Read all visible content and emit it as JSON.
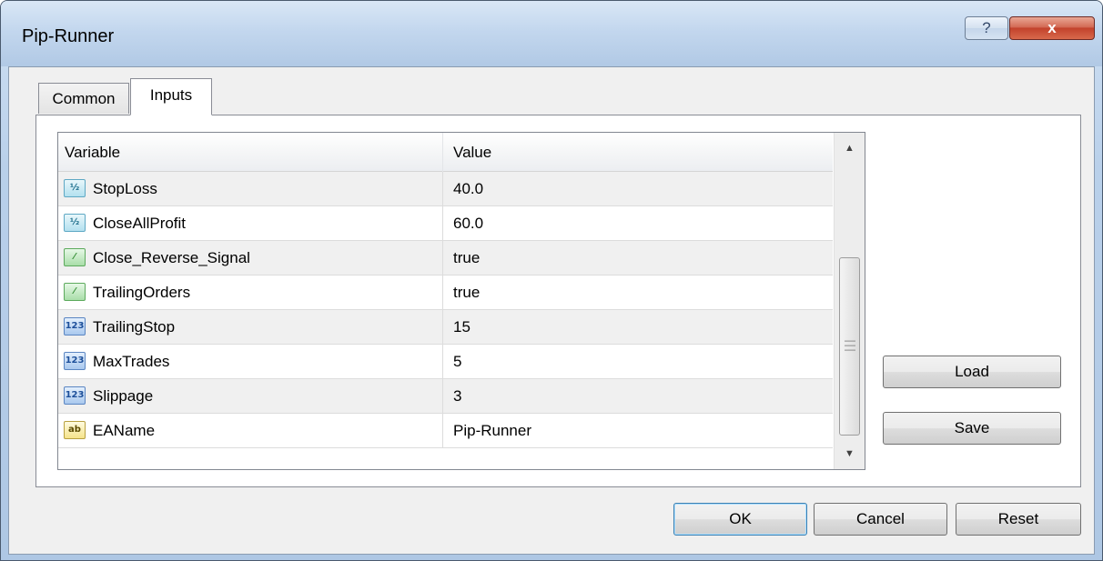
{
  "window": {
    "title": "Pip-Runner",
    "help_label": "?",
    "close_label": "x"
  },
  "tabs": [
    {
      "label": "Common",
      "active": false
    },
    {
      "label": "Inputs",
      "active": true
    }
  ],
  "grid": {
    "columns": [
      "Variable",
      "Value"
    ],
    "rows": [
      {
        "icon": "double-type-icon",
        "icon_text": "½",
        "name": "StopLoss",
        "value": "40.0"
      },
      {
        "icon": "double-type-icon",
        "icon_text": "½",
        "name": "CloseAllProfit",
        "value": "60.0"
      },
      {
        "icon": "bool-type-icon",
        "icon_text": "⁄",
        "name": "Close_Reverse_Signal",
        "value": "true"
      },
      {
        "icon": "bool-type-icon",
        "icon_text": "⁄",
        "name": "TrailingOrders",
        "value": "true"
      },
      {
        "icon": "int-type-icon",
        "icon_text": "123",
        "name": "TrailingStop",
        "value": "15"
      },
      {
        "icon": "int-type-icon",
        "icon_text": "123",
        "name": "MaxTrades",
        "value": "5"
      },
      {
        "icon": "int-type-icon",
        "icon_text": "123",
        "name": "Slippage",
        "value": "3"
      },
      {
        "icon": "string-type-icon",
        "icon_text": "ab",
        "name": "EAName",
        "value": "Pip-Runner"
      }
    ]
  },
  "side_buttons": {
    "load": "Load",
    "save": "Save"
  },
  "footer_buttons": {
    "ok": "OK",
    "cancel": "Cancel",
    "reset": "Reset"
  },
  "colors": {
    "close_button": "#c2422c",
    "title_bar": "#c3d7ee",
    "row_alt": "#f0f0f0"
  }
}
